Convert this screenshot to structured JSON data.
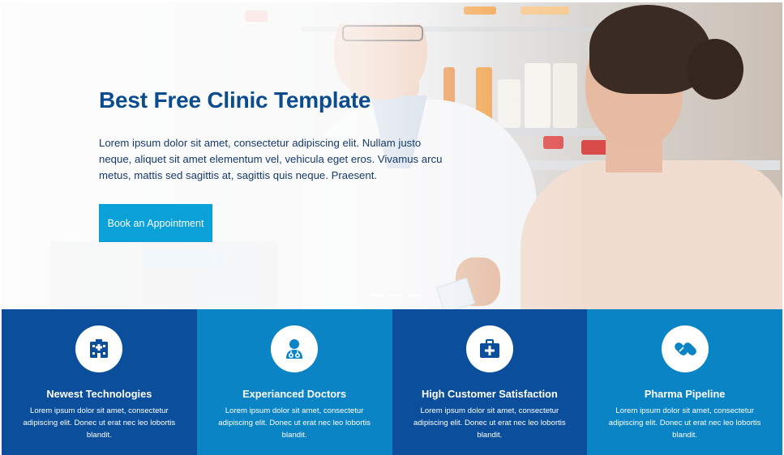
{
  "hero": {
    "title": "Best Free Clinic Template",
    "text": "Lorem ipsum dolor sit amet, consectetur adipiscing elit. Nullam justo neque, aliquet sit amet elementum vel, vehicula eget eros. Vivamus arcu metus, mattis sed sagittis at, sagittis quis neque. Praesent.",
    "button_label": "Book an Appointment",
    "slide_count": 3
  },
  "features": [
    {
      "icon": "hospital-icon",
      "title": "Newest Technologies",
      "text": "Lorem ipsum dolor sit amet, consectetur adipiscing elit. Donec ut erat nec leo lobortis blandit."
    },
    {
      "icon": "doctor-icon",
      "title": "Experianced Doctors",
      "text": "Lorem ipsum dolor sit amet, consectetur adipiscing elit. Donec ut erat nec leo lobortis blandit."
    },
    {
      "icon": "medical-kit-icon",
      "title": "High Customer Satisfaction",
      "text": "Lorem ipsum dolor sit amet, consectetur adipiscing elit. Donec ut erat nec leo lobortis blandit."
    },
    {
      "icon": "pills-icon",
      "title": "Pharma Pipeline",
      "text": "Lorem ipsum dolor sit amet, consectetur adipiscing elit. Donec ut erat nec leo lobortis blandit."
    }
  ],
  "colors": {
    "title": "#0b4c8f",
    "button": "#0aa0d8",
    "feature_dark": "#0b4f9c",
    "feature_light": "#0a84c4"
  }
}
